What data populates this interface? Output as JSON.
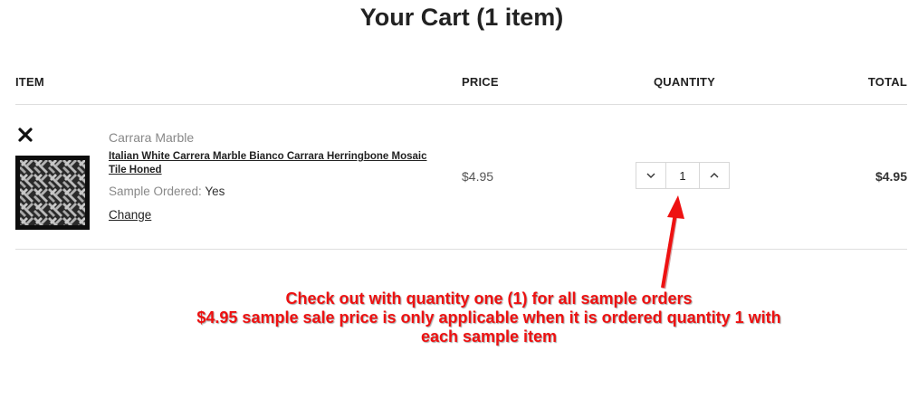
{
  "page": {
    "title": "Your Cart (1 item)"
  },
  "table": {
    "headers": {
      "item": "ITEM",
      "price": "PRICE",
      "quantity": "QUANTITY",
      "total": "TOTAL"
    }
  },
  "cart_item": {
    "brand": "Carrara Marble",
    "name": "Italian White Carrera Marble Bianco Carrara Herringbone Mosaic Tile Honed",
    "sample_label": "Sample Ordered:",
    "sample_value": "Yes",
    "change_label": "Change",
    "price": "$4.95",
    "quantity": "1",
    "total": "$4.95",
    "icons": {
      "remove": "close-icon",
      "decrease": "chevron-down-icon",
      "increase": "chevron-up-icon"
    }
  },
  "annotation": {
    "lines": [
      "Check out with quantity one (1) for all sample orders",
      "$4.95 sample sale price is only applicable when it is ordered quantity 1 with",
      "each sample item"
    ],
    "color": "#ee1111"
  }
}
